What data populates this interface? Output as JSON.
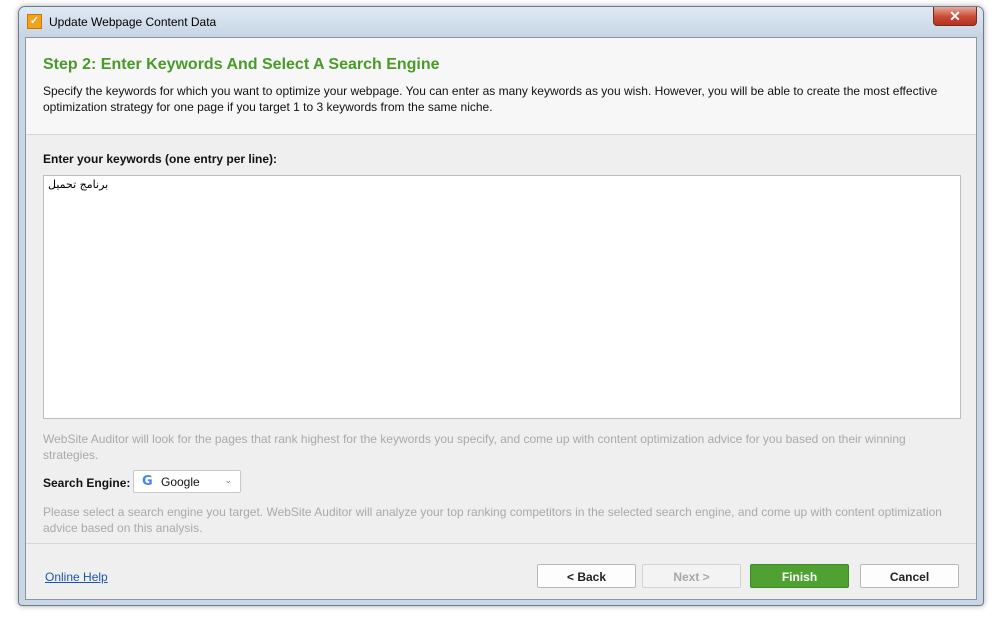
{
  "window": {
    "title": "Update Webpage Content Data",
    "close_label": "✕",
    "icon_glyph": "✓"
  },
  "header": {
    "step_title": "Step 2: Enter Keywords And Select A Search Engine",
    "description": "Specify the keywords for which you want to optimize your webpage. You can enter as many keywords as you wish. However, you will be able to create the most effective optimization strategy for one page if you target 1 to 3 keywords from the same niche."
  },
  "keywords": {
    "label": "Enter your keywords (one entry per line):",
    "value": "برنامج تحميل"
  },
  "hint_top": "WebSite Auditor will look for the pages that rank highest for the keywords you specify, and come up with content optimization advice for you based on their winning strategies.",
  "search_engine": {
    "label": "Search Engine:",
    "icon": "google-icon",
    "icon_glyph": "G",
    "selected": "Google",
    "chevron_glyph": "⌄"
  },
  "hint_bottom": "Please select a search engine you target. WebSite Auditor will analyze your top ranking competitors in the selected search engine, and come up with content optimization advice based on this analysis.",
  "footer": {
    "help_link": "Online Help",
    "back_label": "< Back",
    "next_label": "Next >",
    "finish_label": "Finish",
    "cancel_label": "Cancel"
  },
  "colors": {
    "accent_green": "#4a9a2a",
    "finish_green": "#4fa232",
    "link_blue": "#1a56a8"
  }
}
